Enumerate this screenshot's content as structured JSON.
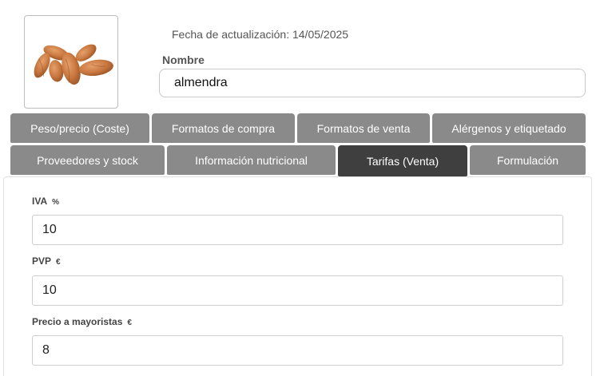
{
  "product": {
    "image_alt": "almendras",
    "updated_text": "Fecha de actualización: 14/05/2025",
    "name_label": "Nombre",
    "name_value": "almendra"
  },
  "tabs": [
    {
      "label": "Peso/precio (Coste)",
      "active": false
    },
    {
      "label": "Formatos de compra",
      "active": false
    },
    {
      "label": "Formatos de venta",
      "active": false
    },
    {
      "label": "Alérgenos y etiquetado",
      "active": false
    },
    {
      "label": "Proveedores y stock",
      "active": false
    },
    {
      "label": "Información nutricional",
      "active": false
    },
    {
      "label": "Tarifas (Venta)",
      "active": true
    },
    {
      "label": "Formulación",
      "active": false
    }
  ],
  "tarifas": {
    "iva": {
      "label": "IVA",
      "unit": "%",
      "value": "10"
    },
    "pvp": {
      "label": "PVP",
      "unit": "€",
      "value": "10"
    },
    "mayoristas": {
      "label": "Precio a mayoristas",
      "unit": "€",
      "value": "8"
    }
  },
  "colors": {
    "tab_inactive": "#8a8a8a",
    "tab_active": "#3f3f3f"
  }
}
